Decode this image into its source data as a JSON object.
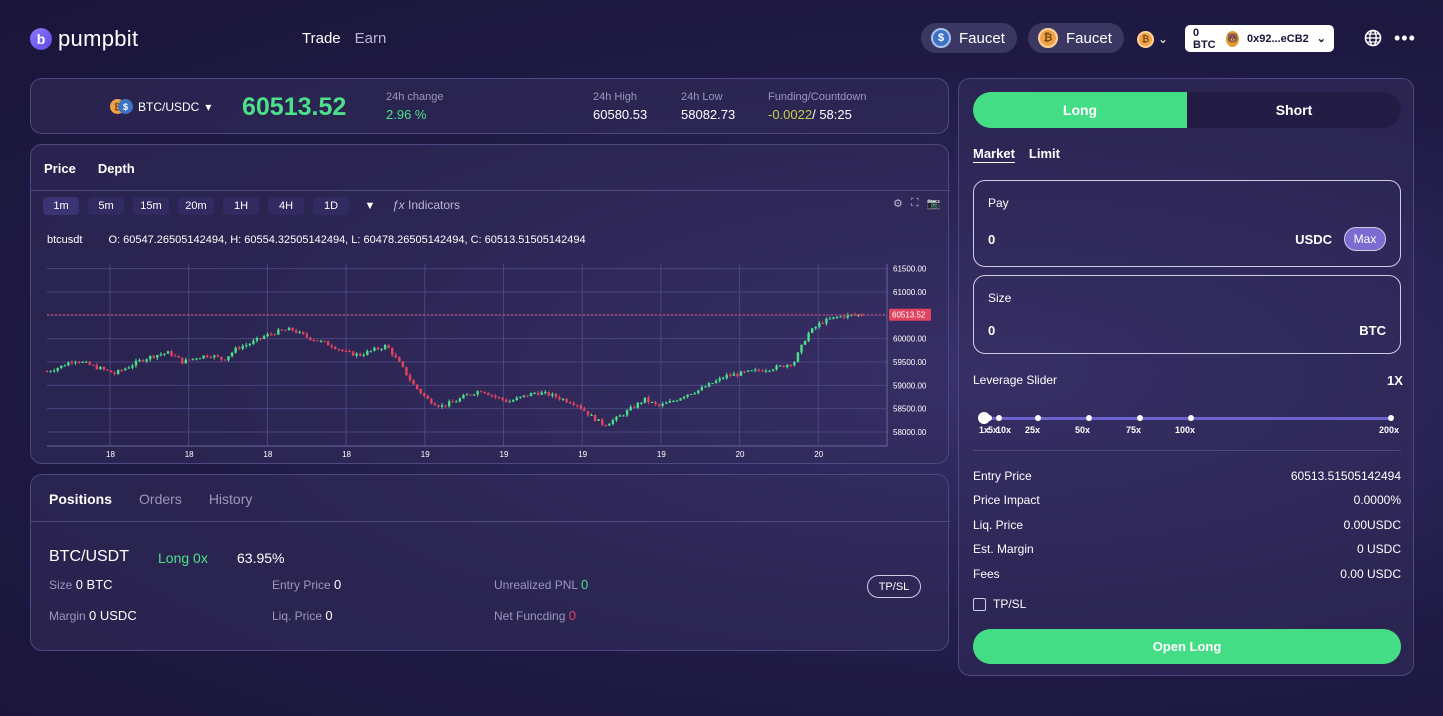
{
  "header": {
    "logo_mark": "b",
    "logo_text": "pumpbit",
    "nav": [
      "Trade",
      "Earn"
    ],
    "faucet_usdc": "Faucet",
    "faucet_btc": "Faucet",
    "wallet_balance": "0 BTC",
    "wallet_address": "0x92...eCB2"
  },
  "ticker": {
    "pair": "BTC/USDC",
    "price": "60513.52",
    "change_label": "24h change",
    "change_value": "2.96 %",
    "high_label": "24h High",
    "high_value": "60580.53",
    "low_label": "24h Low",
    "low_value": "58082.73",
    "funding_label": "Funding/Countdown",
    "funding_rate": "-0.0022",
    "funding_countdown": "/ 58:25"
  },
  "chart_panel": {
    "tabs": [
      "Price",
      "Depth"
    ],
    "intervals": [
      "1m",
      "5m",
      "15m",
      "20m",
      "1H",
      "4H",
      "1D"
    ],
    "indicators_label": "Indicators",
    "symbol": "btcusdt",
    "ohlc": "O: 60547.26505142494, H: 60554.32505142494, L: 60478.26505142494, C: 60513.51505142494"
  },
  "chart_data": {
    "type": "candlestick",
    "symbol": "btcusdt",
    "x_tick_labels": [
      "18",
      "18",
      "18",
      "18",
      "19",
      "19",
      "19",
      "19",
      "20",
      "20"
    ],
    "y_tick_labels": [
      "61500.00",
      "61000.00",
      "60500.00",
      "60000.00",
      "59500.00",
      "59000.00",
      "58500.00",
      "58000.00"
    ],
    "ylim": [
      57700,
      61600
    ],
    "last_price": 60513.52,
    "last_price_label": "60513.52",
    "close_path": [
      59300,
      59400,
      59550,
      59450,
      59350,
      59250,
      59400,
      59550,
      59650,
      59700,
      59500,
      59600,
      59650,
      59550,
      59800,
      59900,
      60050,
      60150,
      60200,
      60050,
      59950,
      59850,
      59700,
      59650,
      59750,
      59850,
      59450,
      59000,
      58700,
      58550,
      58650,
      58800,
      58900,
      58750,
      58650,
      58750,
      58850,
      58800,
      58700,
      58600,
      58350,
      58150,
      58300,
      58500,
      58700,
      58550,
      58650,
      58800,
      58900,
      59050,
      59200,
      59250,
      59300,
      59350,
      59400,
      59500,
      60100,
      60350,
      60450,
      60500,
      60510
    ],
    "grid": true,
    "colors": {
      "up": "#4ce08a",
      "down": "#e2435f",
      "price_line": "#e2435f"
    }
  },
  "positions": {
    "tabs": [
      "Positions",
      "Orders",
      "History"
    ],
    "symbol": "BTC/USDT",
    "side": "Long 0x",
    "pnl_pct": "63.95%",
    "size_label": "Size",
    "size_value": "0 BTC",
    "entry_label": "Entry Price",
    "entry_value": "0",
    "upnl_label": "Unrealized PNL",
    "upnl_value": "0",
    "margin_label": "Margin",
    "margin_value": "0 USDC",
    "liq_label": "Liq. Price",
    "liq_value": "0",
    "funding_label": "Net Funcding",
    "funding_value": "0",
    "tpsl_button": "TP/SL"
  },
  "order": {
    "long": "Long",
    "short": "Short",
    "market": "Market",
    "limit": "Limit",
    "pay_label": "Pay",
    "pay_value": "0",
    "pay_unit": "USDC",
    "max": "Max",
    "size_label": "Size",
    "size_value": "0",
    "size_unit": "BTC",
    "leverage_label": "Leverage Slider",
    "leverage_value": "1X",
    "leverage_marks": [
      "1x",
      "5x",
      "10x",
      "25x",
      "50x",
      "75x",
      "100x",
      "200x"
    ],
    "rows": [
      {
        "label": "Entry Price",
        "value": "60513.51505142494"
      },
      {
        "label": "Price Impact",
        "value": "0.0000%"
      },
      {
        "label": "Liq. Price",
        "value": "0.00USDC"
      },
      {
        "label": "Est. Margin",
        "value": "0 USDC"
      },
      {
        "label": "Fees",
        "value": "0.00 USDC"
      }
    ],
    "tpsl_checkbox": "TP/SL",
    "submit": "Open Long"
  }
}
